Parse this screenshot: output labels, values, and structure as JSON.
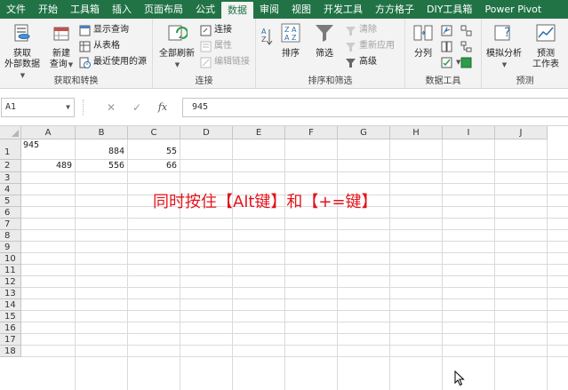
{
  "tabs": [
    {
      "label": "文件",
      "active": false
    },
    {
      "label": "开始",
      "active": false
    },
    {
      "label": "工具箱",
      "active": false
    },
    {
      "label": "插入",
      "active": false
    },
    {
      "label": "页面布局",
      "active": false
    },
    {
      "label": "公式",
      "active": false
    },
    {
      "label": "数据",
      "active": true
    },
    {
      "label": "审阅",
      "active": false
    },
    {
      "label": "视图",
      "active": false
    },
    {
      "label": "开发工具",
      "active": false
    },
    {
      "label": "方方格子",
      "active": false
    },
    {
      "label": "DIY工具箱",
      "active": false
    },
    {
      "label": "Power Pivot",
      "active": false
    }
  ],
  "ribbon": {
    "get_transform": {
      "label": "获取和转换",
      "get_external_line1": "获取",
      "get_external_line2": "外部数据",
      "new_query_line1": "新建",
      "new_query_line2": "查询",
      "show_query": "显示查询",
      "from_table": "从表格",
      "recent_sources": "最近使用的源"
    },
    "connections": {
      "label": "连接",
      "refresh_all": "全部刷新",
      "connections": "连接",
      "properties": "属性",
      "edit_links": "编辑链接"
    },
    "sort_filter": {
      "label": "排序和筛选",
      "sort": "排序",
      "filter": "筛选",
      "clear": "清除",
      "reapply": "重新应用",
      "advanced": "高级"
    },
    "data_tools": {
      "label": "数据工具",
      "text_to_columns": "分列"
    },
    "forecast": {
      "label": "预测",
      "what_if_line1": "模拟分析",
      "forecast_sheet_line1": "预测",
      "forecast_sheet_line2": "工作表"
    }
  },
  "formula_bar": {
    "name_box": "A1",
    "formula": "945",
    "fx_label": "fx"
  },
  "columns": [
    "A",
    "B",
    "C",
    "D",
    "E",
    "F",
    "G",
    "H",
    "I",
    "J"
  ],
  "rows": [
    "1",
    "2",
    "3",
    "4",
    "5",
    "6",
    "7",
    "8",
    "9",
    "10",
    "11",
    "12",
    "13",
    "14",
    "15",
    "16",
    "17",
    "18"
  ],
  "cells": {
    "A1": "945",
    "B1": "884",
    "C1": "55",
    "A2": "489",
    "B2": "556",
    "C2": "66"
  },
  "annotation": "同时按住【Alt键】和【+=键】",
  "colors": {
    "accent": "#217346",
    "annotation": "#e3141c"
  }
}
